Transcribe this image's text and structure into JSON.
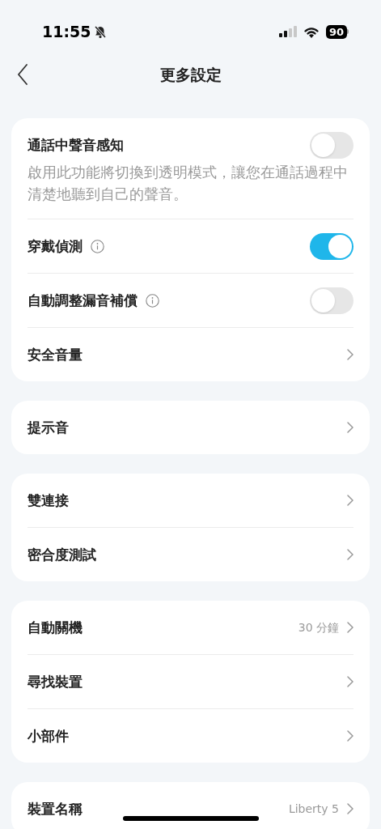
{
  "status_bar": {
    "time": "11:55",
    "battery": "90"
  },
  "header": {
    "title": "更多設定"
  },
  "sections": [
    {
      "items": [
        {
          "kind": "toggle",
          "label": "通話中聲音感知",
          "on": false,
          "description": "啟用此功能將切換到透明模式，讓您在通話過程中清楚地聽到自己的聲音。"
        },
        {
          "kind": "toggle",
          "label": "穿戴偵測",
          "on": true,
          "info": true
        },
        {
          "kind": "toggle",
          "label": "自動調整漏音補償",
          "on": false,
          "info": true
        },
        {
          "kind": "link",
          "label": "安全音量"
        }
      ]
    },
    {
      "items": [
        {
          "kind": "link",
          "label": "提示音"
        }
      ]
    },
    {
      "items": [
        {
          "kind": "link",
          "label": "雙連接"
        },
        {
          "kind": "link",
          "label": "密合度測試"
        }
      ]
    },
    {
      "items": [
        {
          "kind": "link",
          "label": "自動關機",
          "value": "30 分鐘"
        },
        {
          "kind": "link",
          "label": "尋找裝置"
        },
        {
          "kind": "link",
          "label": "小部件"
        }
      ]
    },
    {
      "items": [
        {
          "kind": "link",
          "label": "裝置名稱",
          "value": "Liberty 5"
        }
      ]
    }
  ]
}
